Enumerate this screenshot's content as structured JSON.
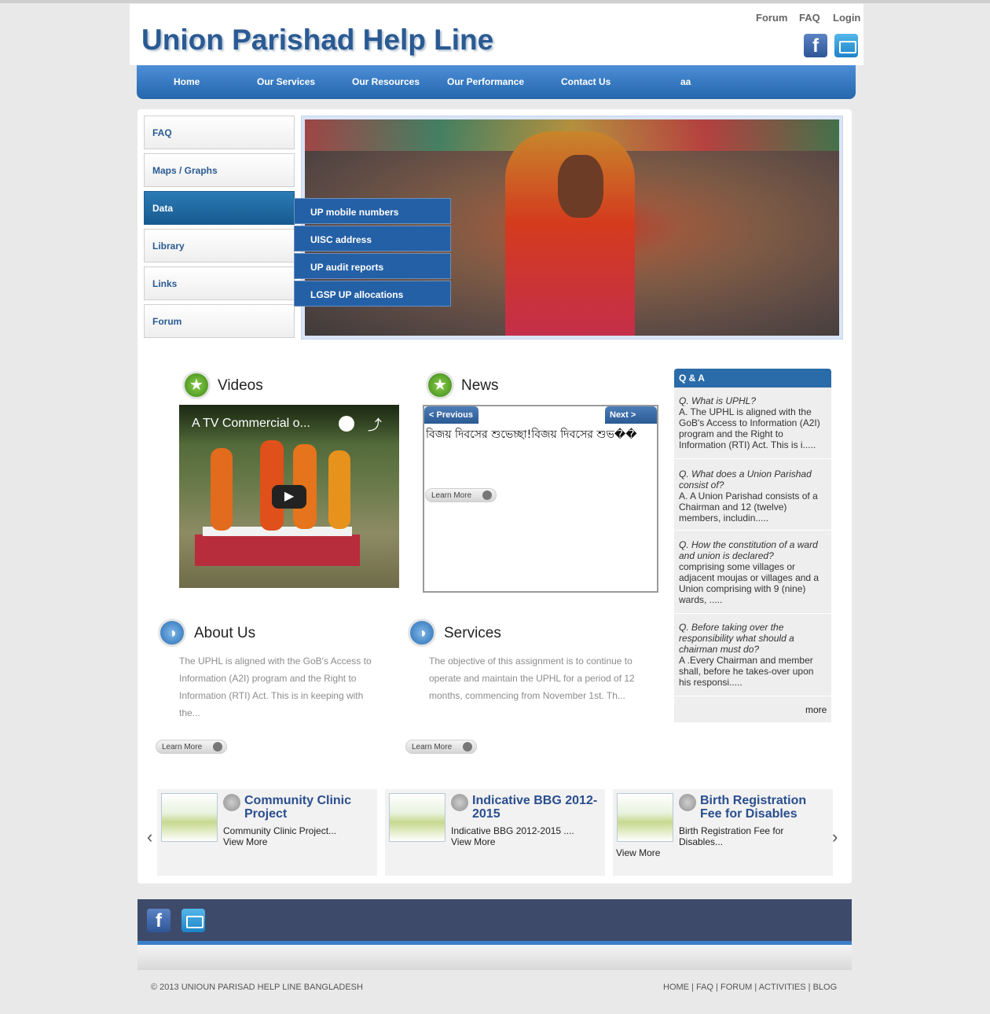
{
  "header": {
    "title": "Union Parishad Help Line",
    "links": [
      "Forum",
      "FAQ",
      "Login"
    ]
  },
  "nav": {
    "items": [
      "Home",
      "Our Services",
      "Our Resources",
      "Our Performance",
      "Contact Us",
      "aa"
    ]
  },
  "sidebar": {
    "items": [
      "FAQ",
      "Maps / Graphs",
      "Data",
      "Library",
      "Links",
      "Forum"
    ],
    "active": "Data"
  },
  "dropdown": {
    "items": [
      "UP mobile numbers",
      "UISC address",
      "UP audit reports",
      "LGSP UP allocations"
    ]
  },
  "videos": {
    "title": "Videos",
    "video_title": "A TV Commercial o..."
  },
  "news": {
    "title": "News",
    "prev": "< Previous",
    "next": "Next >",
    "text": "বিজয় দিবসের শুভেচ্ছা!বিজয় দিবসের শুভ��",
    "learn": "Learn More"
  },
  "qa": {
    "title": "Q & A",
    "items": [
      {
        "q": "Q. What is UPHL?",
        "a": "A. The UPHL is aligned with the GoB's Access to Information (A2I) program and the Right to Information (RTI) Act. This is i....."
      },
      {
        "q": "Q. What does a Union Parishad consist of?",
        "a": " A. A Union Parishad consists of a Chairman and 12 (twelve) members, includin....."
      },
      {
        "q": "Q. How the constitution of a ward and union is declared?",
        "a": "comprising some villages or adjacent moujas or villages and a Union comprising with 9 (nine) wards, ....."
      },
      {
        "q": "Q. Before taking over the responsibility what should a chairman must do?",
        "a": " A .Every Chairman and member shall, before he takes-over upon his responsi....."
      }
    ],
    "more": "more"
  },
  "about": {
    "title": "About Us",
    "text": "The UPHL is aligned with the GoB's Access to Information (A2I) program and the Right to Information (RTI) Act. This is in keeping with the...",
    "learn": "Learn More"
  },
  "services": {
    "title": "Services",
    "text": "The objective of this assignment is to continue to operate and maintain the UPHL for a period of 12 months, commencing from November 1st. Th...",
    "learn": "Learn More"
  },
  "cards": [
    {
      "title": "Community Clinic Project",
      "text": "Community Clinic Project...",
      "more": "View More"
    },
    {
      "title": "Indicative BBG 2012-2015",
      "text": "Indicative BBG 2012-2015 ....",
      "more": "View More"
    },
    {
      "title": "Birth Registration Fee for Disables",
      "text": "Birth Registration Fee for Disables...",
      "more": "View More"
    }
  ],
  "footer": {
    "copyright": "© 2013 UNIOUN PARISAD HELP LINE BANGLADESH",
    "links": [
      "HOME",
      "FAQ",
      "FORUM",
      "ACTIVITIES",
      "BLOG"
    ]
  }
}
